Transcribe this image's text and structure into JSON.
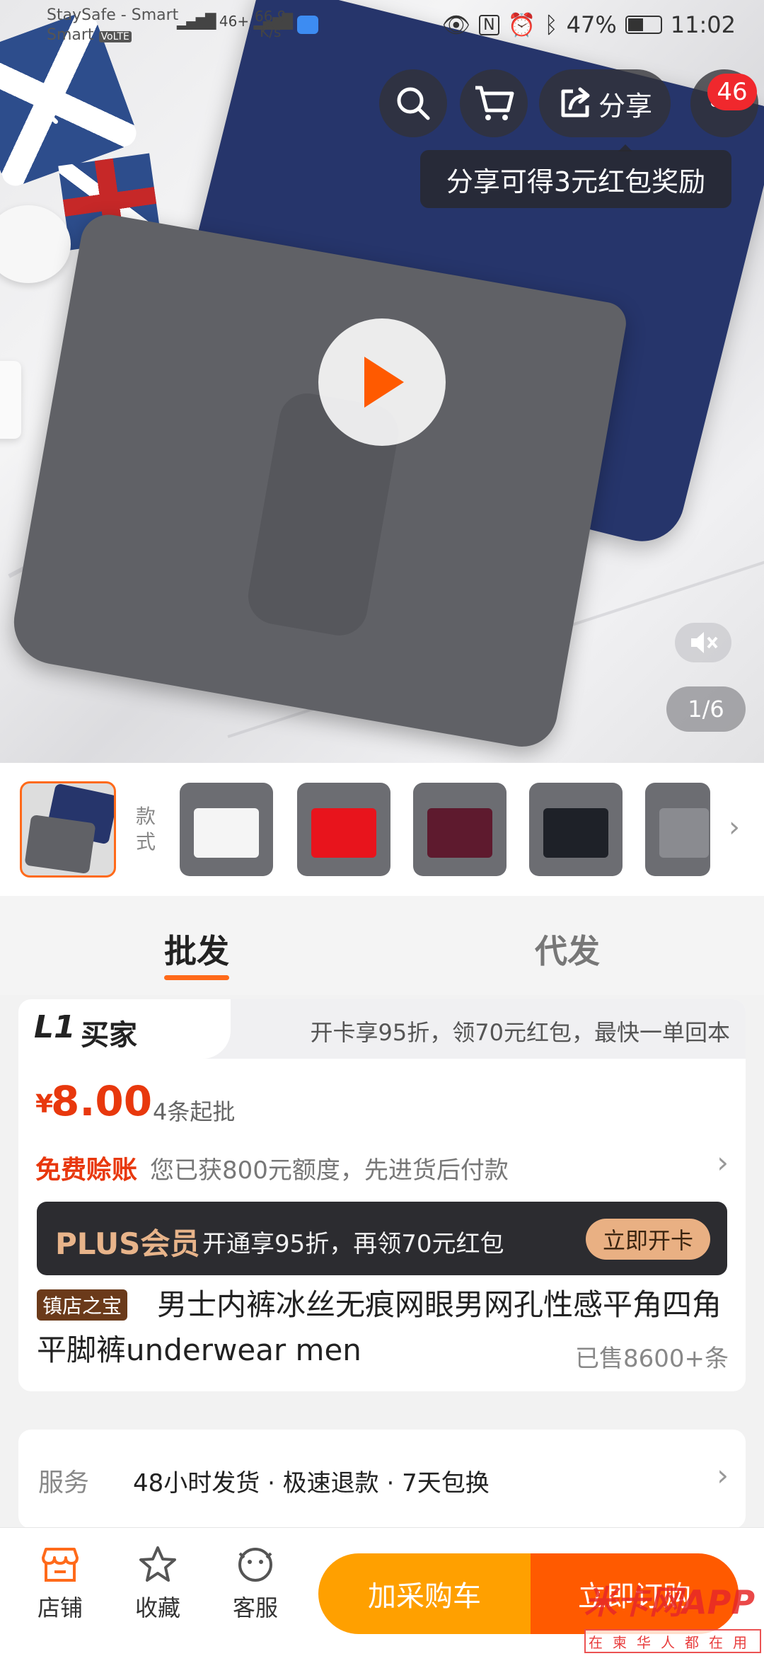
{
  "status_bar": {
    "carrier_line1": "StaySafe - Smart",
    "carrier_line2": "Smart",
    "volte": "VoLTE",
    "network": "46+",
    "speed_value": "66.9",
    "speed_unit": "K/s",
    "nfc": "N",
    "battery_text": "47%",
    "battery_level": 0.47,
    "time": "11:02"
  },
  "header": {
    "share_label": "分享",
    "notification_count": "46",
    "share_tooltip": "分享可得3元红包奖励"
  },
  "gallery": {
    "page_indicator": "1/6",
    "style_label": "款式",
    "swatch_colors": [
      "#f5f5f5",
      "#e8141c",
      "#5e1a2e",
      "#1e2128",
      "#8a8b90"
    ]
  },
  "tabs": {
    "wholesale": "批发",
    "dropship": "代发"
  },
  "card": {
    "l1_tag": "L1",
    "buyer_label": "买家",
    "l1_promo": "开卡享95折，领70元红包，最快一单回本",
    "currency": "¥",
    "price": "8.00",
    "moq": "4条起批",
    "credit_label": "免费赊账",
    "credit_desc": "您已获800元额度，先进货后付款",
    "plus_title": "PLUS会员",
    "plus_desc": "开通享95折，再领70元红包",
    "plus_button": "立即开卡",
    "title_badge": "镇店之宝",
    "title": "男士内裤冰丝无痕网眼男网孔性感平角四角平脚裤underwear men",
    "sold": "已售8600+条"
  },
  "service": {
    "label": "服务",
    "text": "48小时发货 · 极速退款 · 7天包换"
  },
  "bottom_bar": {
    "shop_label": "店铺",
    "favorite_label": "收藏",
    "service_label": "客服",
    "add_to_cart": "加采购车",
    "buy_now": "立即订购"
  },
  "watermark": {
    "title": "米卡网APP",
    "subtitle": "在柬华人都在用"
  },
  "colors": {
    "accent_orange": "#ff6a1a",
    "price_red": "#e8380d",
    "cart_yellow": "#ffa000",
    "buy_orange": "#ff5a00",
    "plus_gold": "#e9b083"
  }
}
